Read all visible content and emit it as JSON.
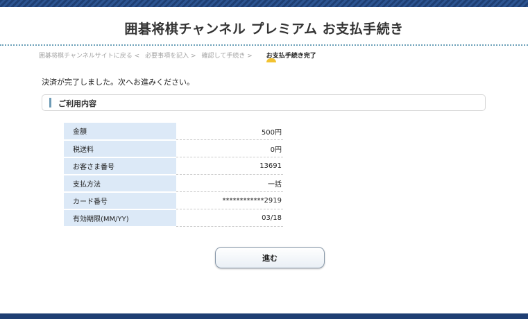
{
  "header": {
    "title": "囲碁将棋チャンネル プレミアム お支払手続き"
  },
  "steps": [
    {
      "label": "囲碁将棋チャンネルサイトに戻る <"
    },
    {
      "label": "必要事項を記入 >"
    },
    {
      "label": "確認して手続き >"
    },
    {
      "label": "お支払手続き完了"
    }
  ],
  "message": "決済が完了しました。次へお進みください。",
  "section": {
    "title": "ご利用内容"
  },
  "details": [
    {
      "label": "金額",
      "value": "500円"
    },
    {
      "label": "税送料",
      "value": "0円"
    },
    {
      "label": "お客さま番号",
      "value": "13691"
    },
    {
      "label": "支払方法",
      "value": "一括"
    },
    {
      "label": "カード番号",
      "value": "************2919"
    },
    {
      "label": "有効期限(MM/YY)",
      "value": "03/18"
    }
  ],
  "next_button": "進む",
  "colors": {
    "header_bar": "#1f3f73",
    "label_bg": "#dce9f7",
    "accent_bar": "#6e9bb6",
    "current_marker": "#f2c230"
  }
}
